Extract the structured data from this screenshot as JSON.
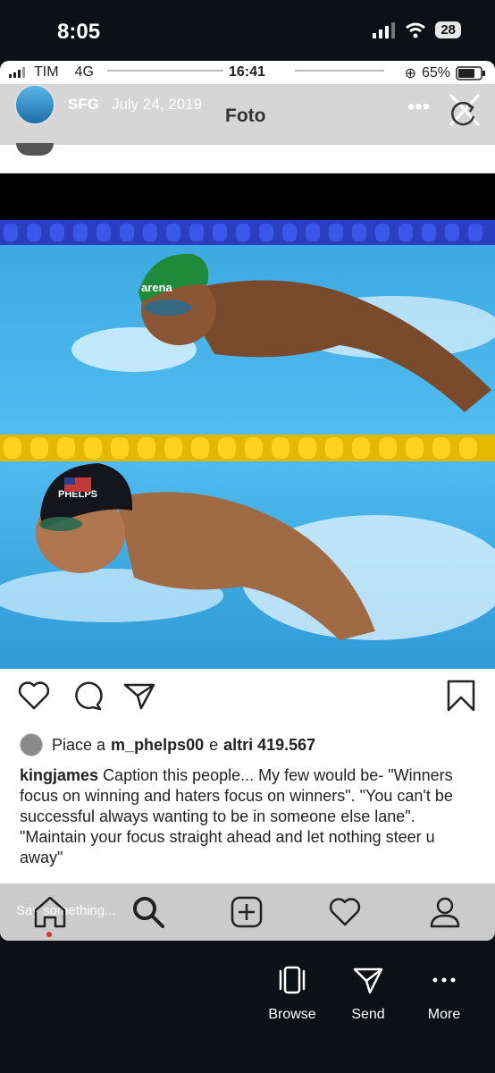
{
  "outer_status": {
    "time": "8:05",
    "battery": "28"
  },
  "inner_status": {
    "carrier": "TIM",
    "network": "4G",
    "time": "16:41",
    "battery": "65%"
  },
  "overlay": {
    "username": "SFG",
    "date": "July 24, 2019",
    "title": "Foto"
  },
  "post": {
    "likes_prefix": "Piace a",
    "liked_by": "m_phelps00",
    "likes_mid": "e",
    "likes_count": "altri 419.567",
    "caption_user": "kingjames",
    "caption_text": "Caption this people... My few would be- \"Winners focus on winning and haters focus on winners\". \"You can't be successful always wanting to be in someone else lane\". \"Maintain your focus straight ahead and let nothing steer u away\""
  },
  "bottom_nav": {
    "placeholder": "Say something..."
  },
  "sheet": {
    "browse": "Browse",
    "send": "Send",
    "more": "More"
  },
  "photo": {
    "cap_brand": "arena",
    "cap_name": "PHELPS"
  },
  "icons": [
    "heart-icon",
    "comment-icon",
    "share-icon",
    "bookmark-icon",
    "home-icon",
    "search-icon",
    "add-icon",
    "activity-icon",
    "profile-icon",
    "rotate-icon",
    "close-icon",
    "browse-icon",
    "send-icon",
    "more-icon"
  ]
}
